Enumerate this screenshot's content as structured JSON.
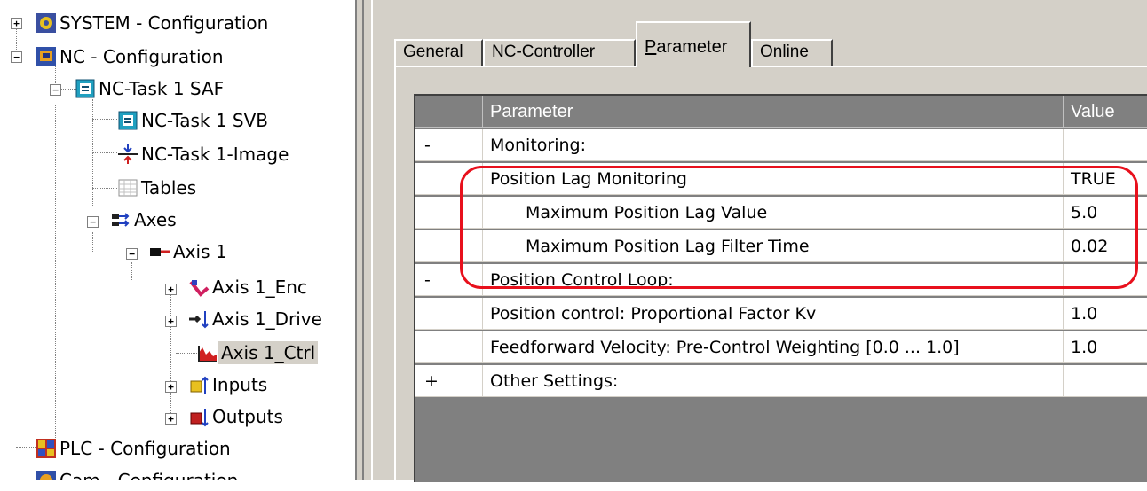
{
  "tree": {
    "items": [
      {
        "label": "SYSTEM - Configuration",
        "icon": "system-config-icon"
      },
      {
        "label": "NC - Configuration",
        "icon": "nc-config-icon"
      },
      {
        "label": "NC-Task 1 SAF",
        "icon": "task-icon"
      },
      {
        "label": "NC-Task 1 SVB",
        "icon": "task-icon"
      },
      {
        "label": "NC-Task 1-Image",
        "icon": "image-icon"
      },
      {
        "label": "Tables",
        "icon": "table-icon"
      },
      {
        "label": "Axes",
        "icon": "axes-icon"
      },
      {
        "label": "Axis 1",
        "icon": "axis-icon"
      },
      {
        "label": "Axis 1_Enc",
        "icon": "encoder-icon"
      },
      {
        "label": "Axis 1_Drive",
        "icon": "drive-icon"
      },
      {
        "label": "Axis 1_Ctrl",
        "icon": "controller-icon",
        "selected": true
      },
      {
        "label": "Inputs",
        "icon": "inputs-icon"
      },
      {
        "label": "Outputs",
        "icon": "outputs-icon"
      },
      {
        "label": "PLC - Configuration",
        "icon": "plc-config-icon"
      },
      {
        "label": "Cam - Configuration",
        "icon": "cam-config-icon"
      }
    ]
  },
  "tabs": {
    "general": "General",
    "nc_controller": "NC-Controller",
    "parameter_first": "P",
    "parameter_rest": "arameter",
    "online": "Online"
  },
  "grid": {
    "headers": {
      "parameter": "Parameter",
      "value": "Value"
    },
    "rows": [
      {
        "marker": "-",
        "name": "Monitoring:",
        "value": "",
        "group": true
      },
      {
        "marker": "",
        "name": "Position Lag Monitoring",
        "value": "TRUE"
      },
      {
        "marker": "",
        "name": "Maximum Position Lag Value",
        "value": "5.0",
        "indent": true
      },
      {
        "marker": "",
        "name": "Maximum Position Lag Filter Time",
        "value": "0.02",
        "indent": true
      },
      {
        "marker": "-",
        "name": "Position Control Loop:",
        "value": "",
        "group": true
      },
      {
        "marker": "",
        "name": "Position control: Proportional Factor Kv",
        "value": "1.0"
      },
      {
        "marker": "",
        "name": "Feedforward Velocity: Pre-Control Weighting [0.0 ... 1.0]",
        "value": "1.0"
      },
      {
        "marker": "+",
        "name": "Other Settings:",
        "value": "",
        "group": true
      }
    ]
  },
  "colors": {
    "highlight": "#e8101c",
    "panel": "#d4d0c8",
    "grid_bg": "#808080"
  }
}
